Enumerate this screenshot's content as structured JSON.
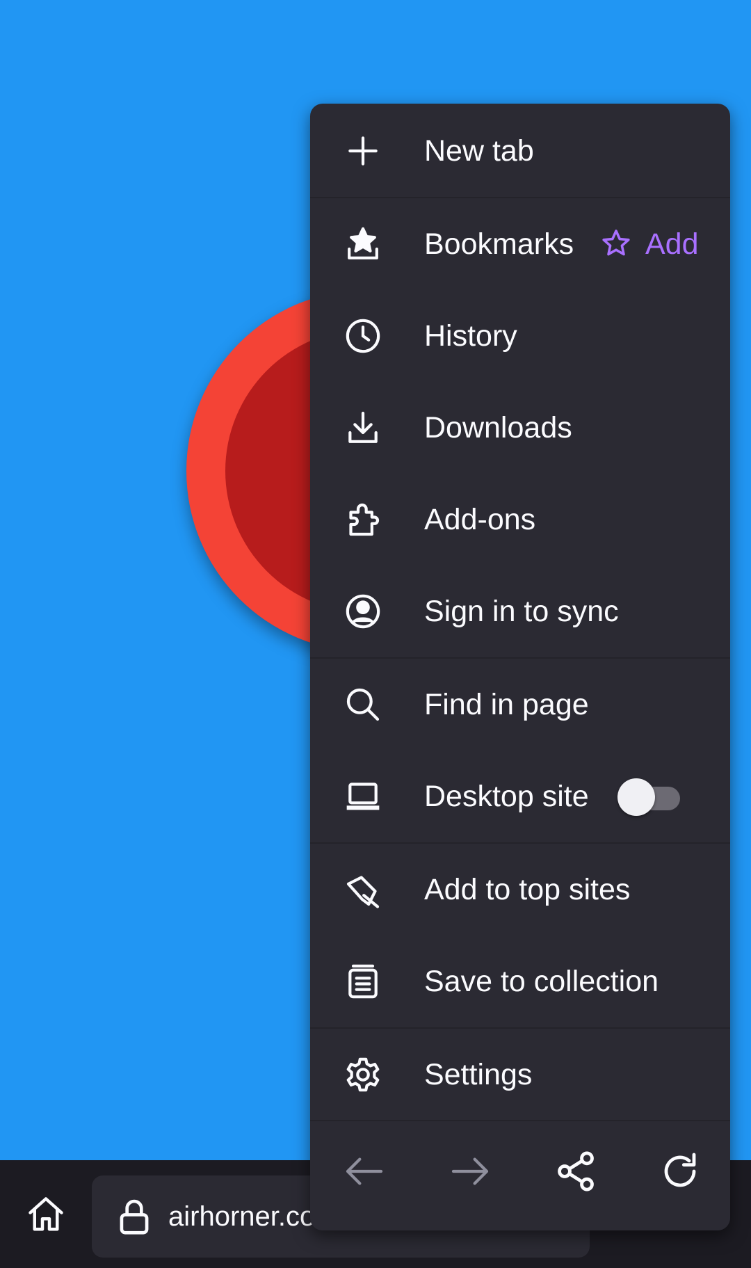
{
  "page": {
    "background_color": "#2196f3",
    "horn_outer_color": "#f44336",
    "horn_inner_color": "#b71c1c"
  },
  "menu": {
    "background_color": "#2b2a33",
    "items": [
      {
        "label": "New tab",
        "icon": "plus-icon"
      },
      {
        "label": "Bookmarks",
        "icon": "bookmarks-icon"
      },
      {
        "label": "History",
        "icon": "clock-icon"
      },
      {
        "label": "Downloads",
        "icon": "download-icon"
      },
      {
        "label": "Add-ons",
        "icon": "puzzle-icon"
      },
      {
        "label": "Sign in to sync",
        "icon": "account-icon"
      },
      {
        "label": "Find in page",
        "icon": "search-icon"
      },
      {
        "label": "Desktop site",
        "icon": "laptop-icon"
      },
      {
        "label": "Add to top sites",
        "icon": "pin-icon"
      },
      {
        "label": "Save to collection",
        "icon": "collection-icon"
      },
      {
        "label": "Settings",
        "icon": "gear-icon"
      }
    ],
    "bookmark_add_label": "Add",
    "bookmark_add_icon": "star-outline-icon",
    "accent_color": "#a970ff",
    "desktop_site_enabled": false,
    "nav": [
      {
        "name": "back",
        "icon": "arrow-left-icon",
        "enabled": false
      },
      {
        "name": "forward",
        "icon": "arrow-right-icon",
        "enabled": false
      },
      {
        "name": "share",
        "icon": "share-icon",
        "enabled": true
      },
      {
        "name": "reload",
        "icon": "reload-icon",
        "enabled": true
      }
    ]
  },
  "toolbar": {
    "background_color": "#1c1b22",
    "url_text": "airhorner.com",
    "home_icon": "home-icon",
    "lock_icon": "lock-icon"
  }
}
